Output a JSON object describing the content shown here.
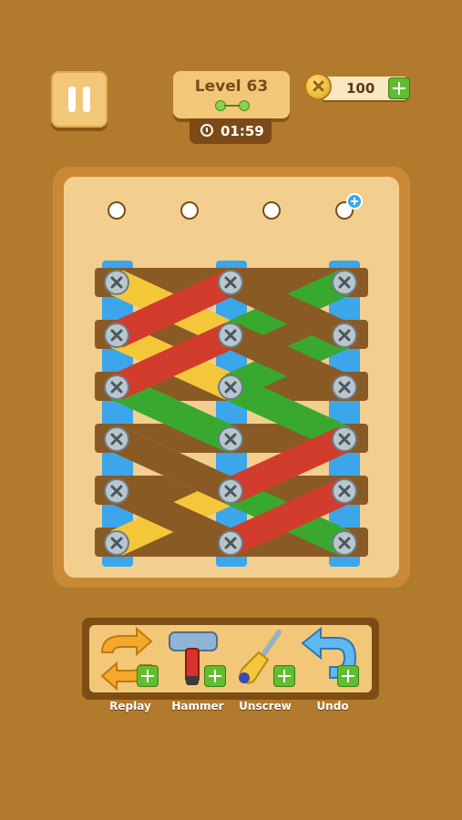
{
  "header": {
    "level_label": "Level 63",
    "timer": "01:59",
    "coins": "100"
  },
  "tools": [
    {
      "label": "Replay",
      "icon": "replay-icon"
    },
    {
      "label": "Hammer",
      "icon": "hammer-icon"
    },
    {
      "label": "Unscrew",
      "icon": "screwdriver-icon"
    },
    {
      "label": "Undo",
      "icon": "undo-icon"
    }
  ],
  "colors": {
    "background": "#b27a2c",
    "board": "#f2cf8f",
    "plank_blue": "#3ba6ea",
    "plank_red": "#d23c2c",
    "plank_green": "#39a82f",
    "plank_yellow": "#f4c63a",
    "plank_brown": "#8a5a24",
    "accent_green": "#5fbd2e"
  }
}
